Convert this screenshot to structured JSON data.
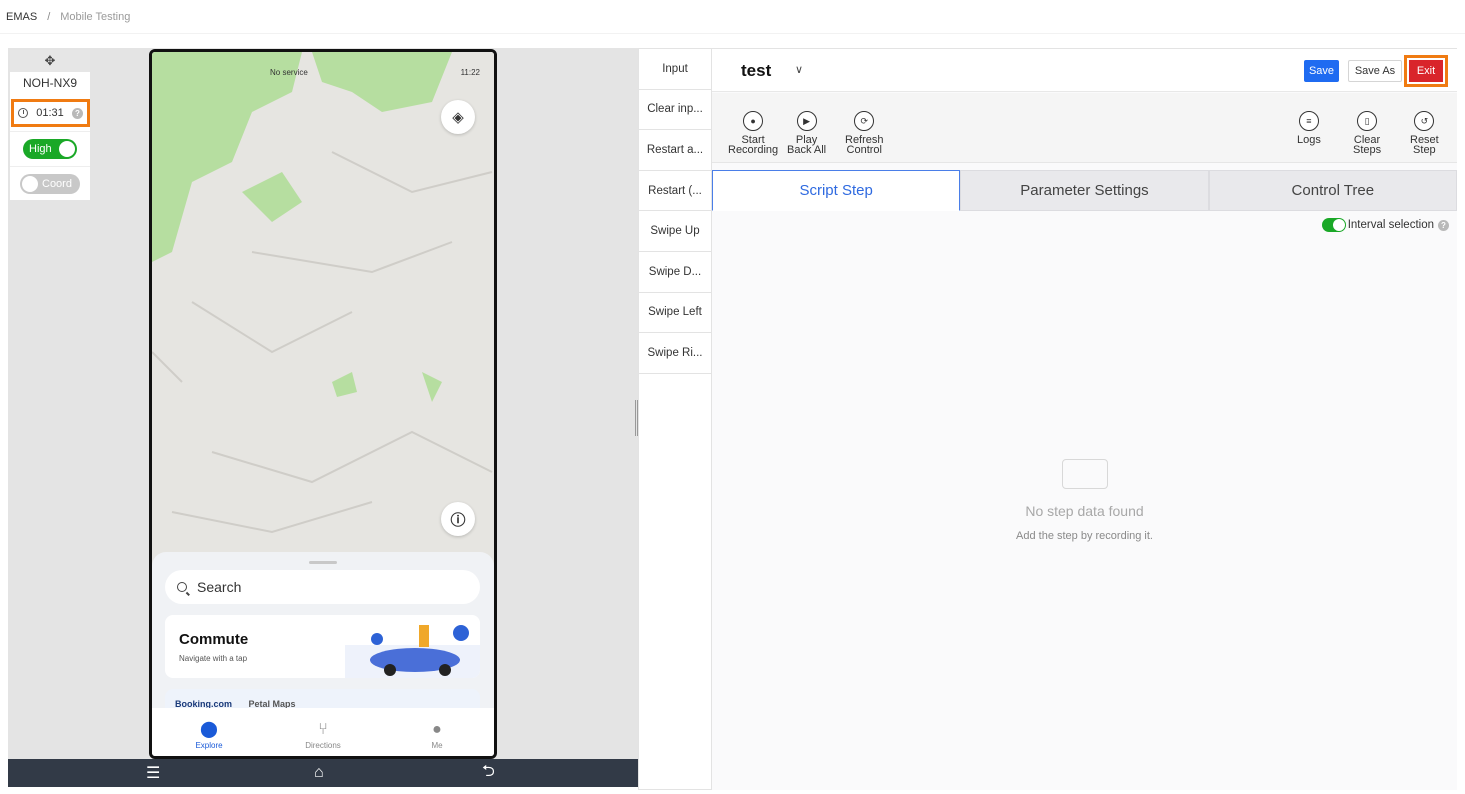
{
  "breadcrumb": {
    "root": "EMAS",
    "separator": "/",
    "current": "Mobile Testing"
  },
  "device": {
    "name": "NOH-NX9",
    "timer": "01:31",
    "quality_label": "High",
    "coord_label": "Coord"
  },
  "phone": {
    "status_left": "No service",
    "status_time": "11:22",
    "search_placeholder": "Search",
    "commute_title": "Commute",
    "commute_subtitle": "Navigate with a tap",
    "promo_brand1": "Booking.com",
    "promo_brand2": "Petal Maps",
    "tabs": [
      "Explore",
      "Directions",
      "Me"
    ]
  },
  "actions": [
    "Input",
    "Clear inp...",
    "Restart a...",
    "Restart (...",
    "Swipe Up",
    "Swipe D...",
    "Swipe Left",
    "Swipe Ri..."
  ],
  "script": {
    "name": "test"
  },
  "buttons": {
    "save": "Save",
    "save_as": "Save As",
    "exit": "Exit"
  },
  "toolbar": {
    "start_recording": [
      "Start",
      "Recording"
    ],
    "play_back_all": [
      "Play",
      "Back All"
    ],
    "refresh_control": [
      "Refresh",
      "Control"
    ],
    "logs": [
      "Logs"
    ],
    "clear_steps": [
      "Clear",
      "Steps"
    ],
    "reset_step": [
      "Reset",
      "Step"
    ]
  },
  "panel_tabs": [
    "Script Step",
    "Parameter Settings",
    "Control Tree"
  ],
  "interval_selection": "Interval selection",
  "empty": {
    "title": "No step data found",
    "subtitle": "Add the step by recording it."
  },
  "colors": {
    "primary": "#1f6bf1",
    "exit": "#d9252b",
    "highlight": "#f07b12",
    "toggle_on": "#1aa827"
  }
}
